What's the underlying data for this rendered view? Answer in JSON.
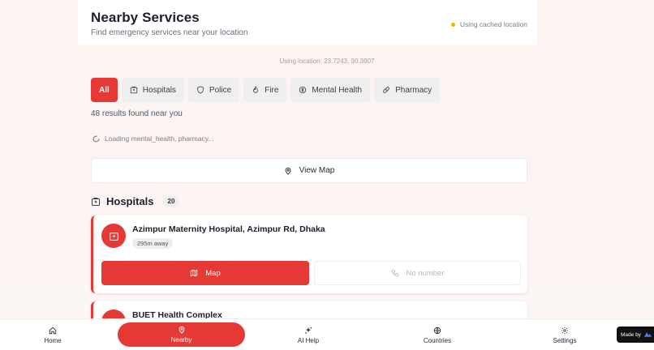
{
  "header": {
    "title": "Nearby Services",
    "subtitle": "Find emergency services near your location",
    "cached_status": "Using cached location"
  },
  "location_text": "Using location: 23.7243, 90.3907",
  "filters": [
    {
      "label": "All",
      "icon": "none",
      "active": true
    },
    {
      "label": "Hospitals",
      "icon": "hospital-icon"
    },
    {
      "label": "Police",
      "icon": "shield-icon"
    },
    {
      "label": "Fire",
      "icon": "flame-icon"
    },
    {
      "label": "Mental Health",
      "icon": "brain-icon"
    },
    {
      "label": "Pharmacy",
      "icon": "pill-icon"
    }
  ],
  "results_text": "48 results found near you",
  "loading_text": "Loading mental_health, pharmacy...",
  "view_map_label": "View Map",
  "section": {
    "title": "Hospitals",
    "count": "20"
  },
  "cards": [
    {
      "name": "Azimpur Maternity Hospital, Azimpur Rd, Dhaka",
      "distance": "295m away",
      "map_label": "Map",
      "phone_label": "No number"
    },
    {
      "name": "BUET Health Complex"
    }
  ],
  "nav": [
    {
      "label": "Home",
      "icon": "home-icon"
    },
    {
      "label": "Nearby",
      "icon": "map-pin-icon",
      "active": true
    },
    {
      "label": "AI Help",
      "icon": "sparkles-icon"
    },
    {
      "label": "Countries",
      "icon": "globe-icon"
    },
    {
      "label": "Settings",
      "icon": "gear-icon"
    }
  ],
  "made_by": "Made by",
  "colors": {
    "accent": "#e53935",
    "warning": "#f0b400"
  }
}
